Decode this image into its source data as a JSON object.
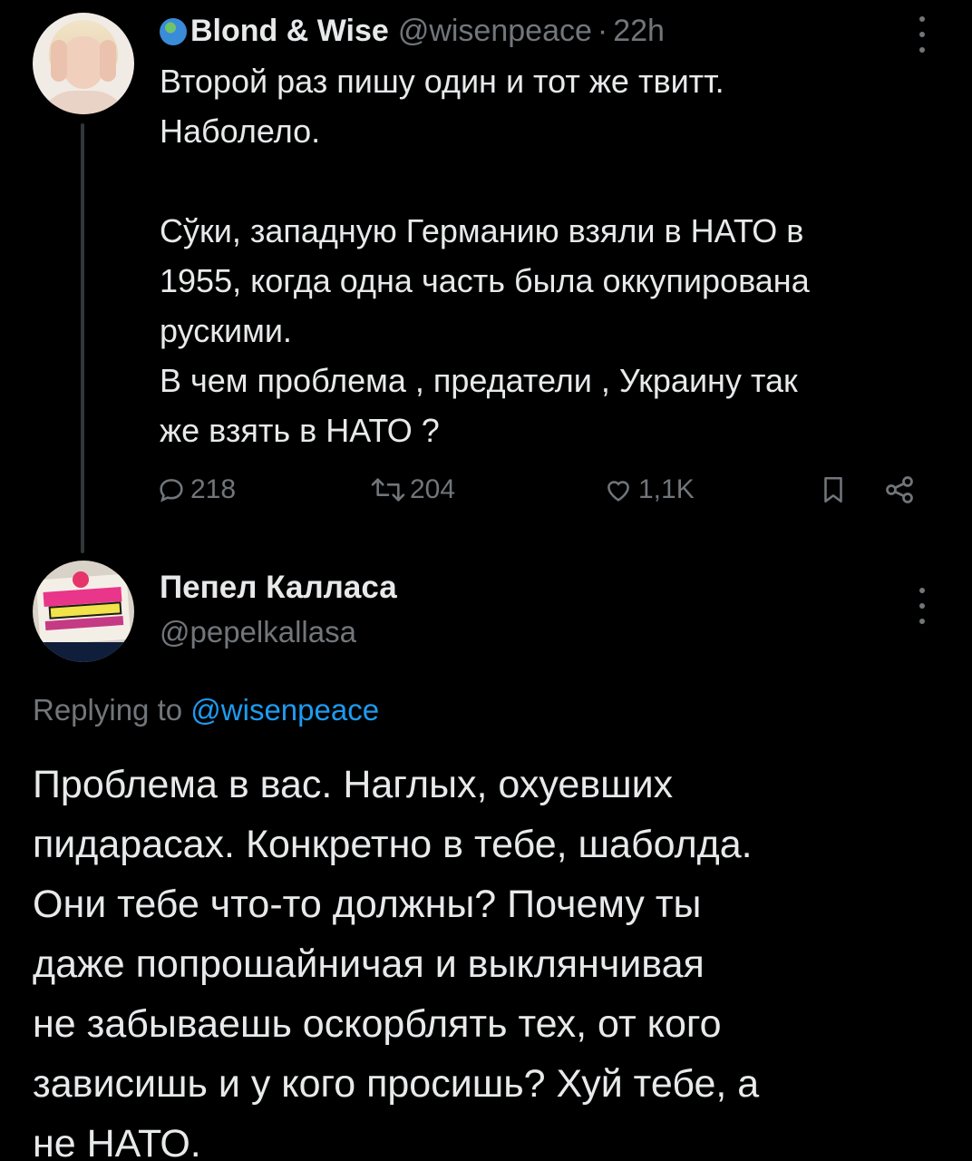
{
  "parent_tweet": {
    "author_name": "Blond & Wise",
    "author_handle": "@wisenpeace",
    "separator": "·",
    "time": "22h",
    "text": "Второй раз пишу один и тот же твитт.\nНаболело.\n\nСўки, западную Германию взяли в НАТО в\n1955, когда одна часть была оккупирована\nрускими.\nВ чем проблема , предатели , Украину так\nже взять в НАТО ?",
    "stats": {
      "replies": "218",
      "retweets": "204",
      "likes": "1,1K"
    }
  },
  "reply_tweet": {
    "author_name": "Пепел Калласа",
    "author_handle": "@pepelkallasa",
    "replying_prefix": "Replying to",
    "replying_mention": "@wisenpeace",
    "text": "Проблема в вас. Наглых, охуевших\nпидарасах. Конкретно в тебе, шаболда.\nОни тебе что-то должны? Почему ты\nдаже попрошайничая и выклянчивая\nне забываешь оскорблять тех, от кого\nзависишь и у кого просишь? Хуй тебе, а\nне НАТО."
  },
  "icons": {
    "verified_badge": "globe-icon",
    "more": "more-icon",
    "reply": "reply-icon",
    "retweet": "retweet-icon",
    "like": "like-icon",
    "bookmark": "bookmark-icon",
    "share": "share-icon"
  },
  "colors": {
    "background": "#000000",
    "primary_text": "#e7e9ea",
    "secondary_text": "#71767b",
    "accent": "#1d9bf0",
    "thread_line": "#333639"
  }
}
